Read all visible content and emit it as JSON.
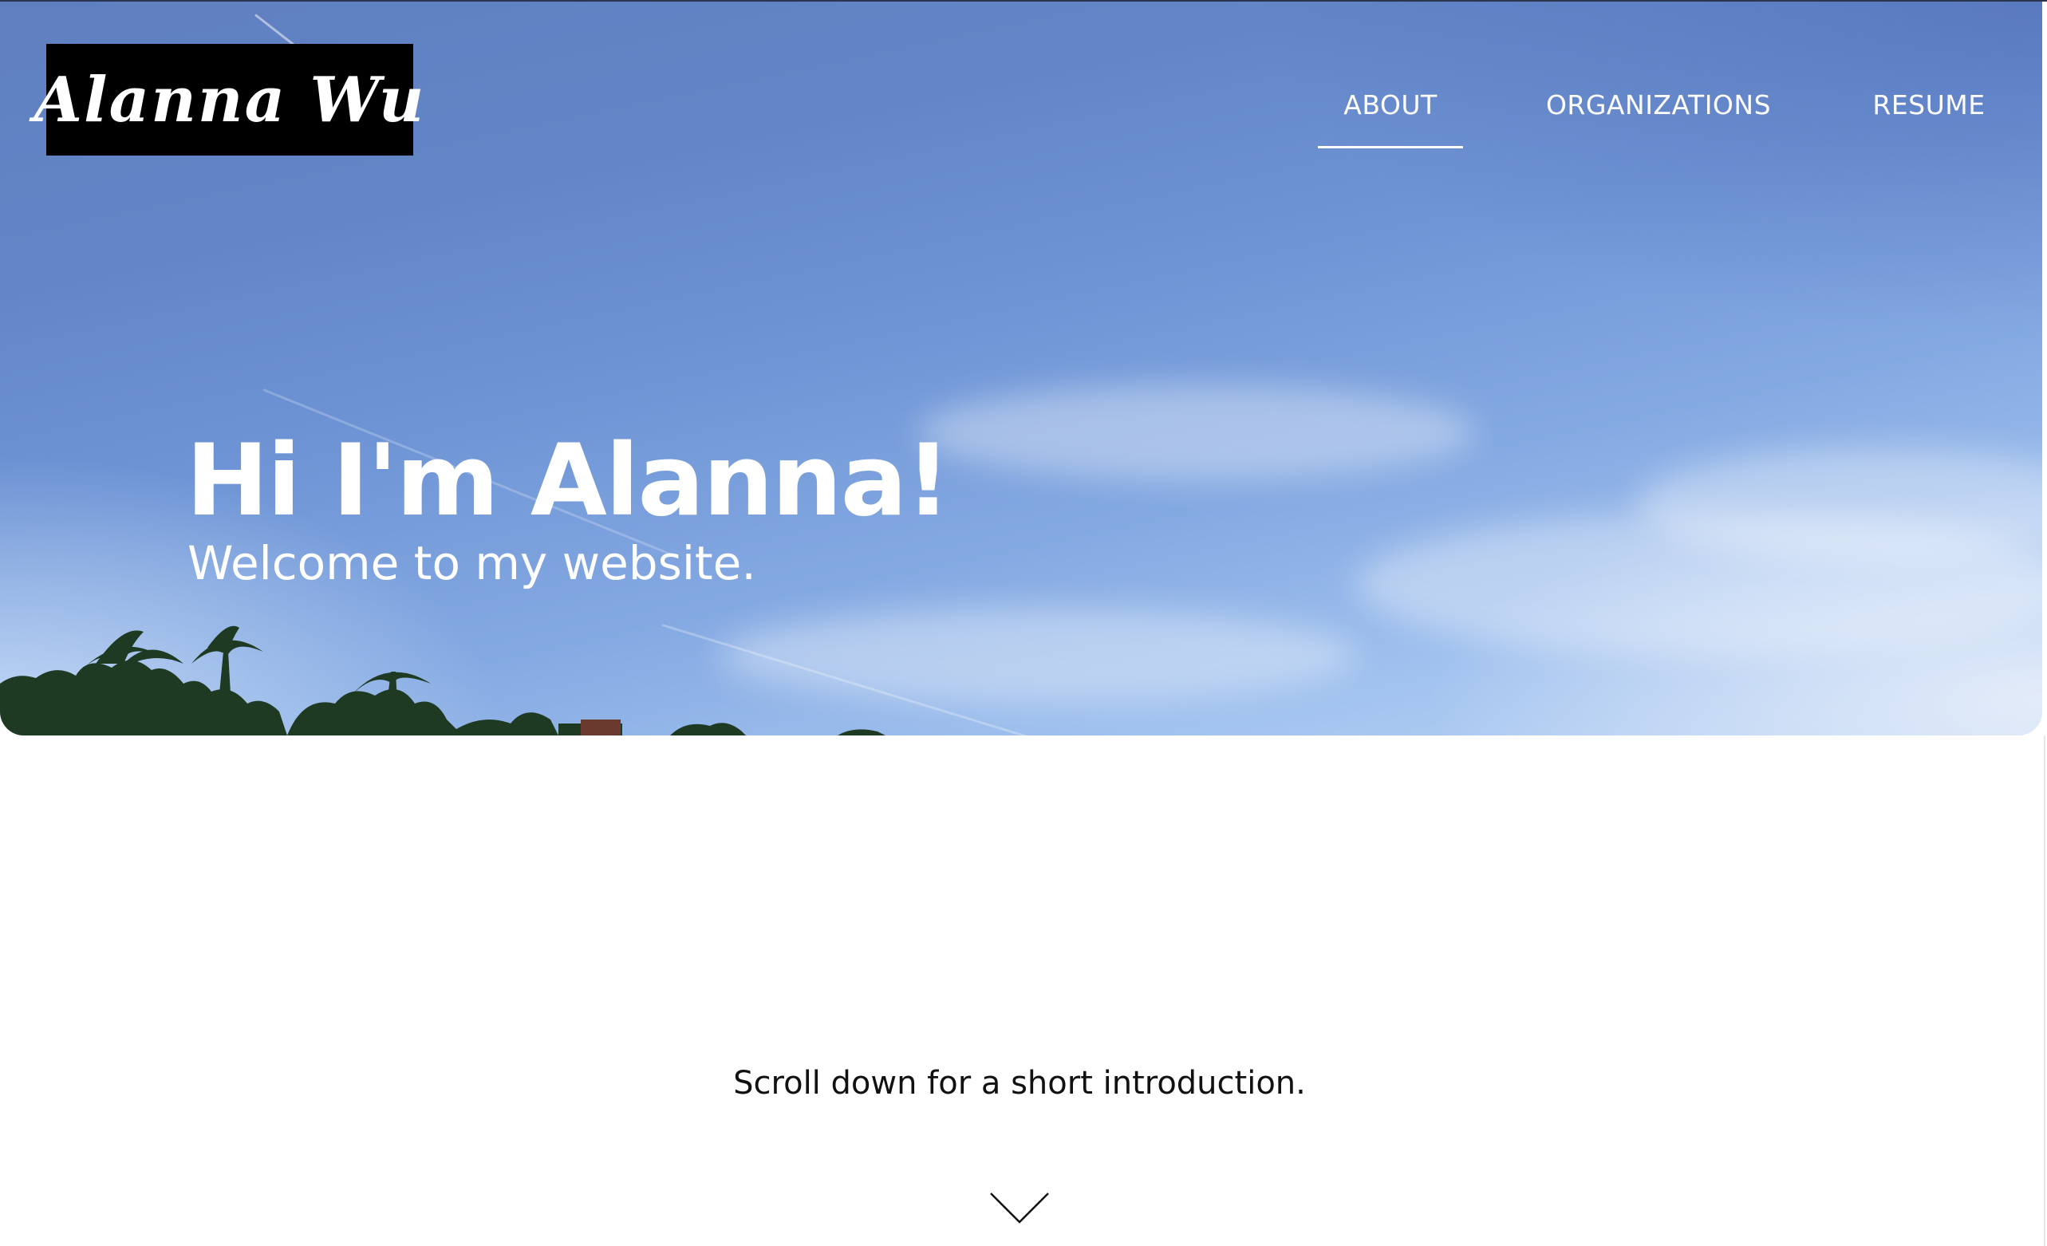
{
  "site": {
    "logo_text": "Alanna Wu"
  },
  "nav": {
    "items": [
      {
        "label": "ABOUT",
        "active": true
      },
      {
        "label": "ORGANIZATIONS",
        "active": false
      },
      {
        "label": "RESUME",
        "active": false
      }
    ]
  },
  "hero": {
    "title": "Hi I'm Alanna!",
    "subtitle": "Welcome to my website."
  },
  "intro": {
    "text": "Scroll down for a short introduction."
  },
  "icons": {
    "scroll": "chevron-down-icon"
  },
  "colors": {
    "nav_text": "#ffffff",
    "logo_background": "#000000",
    "body_text": "#111111"
  }
}
